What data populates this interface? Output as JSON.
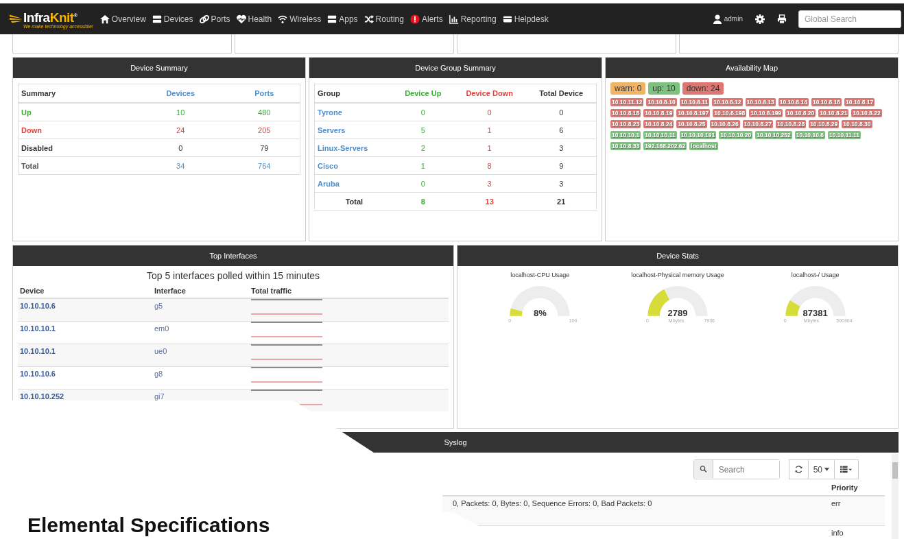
{
  "brand": {
    "name_a": "Infra",
    "name_b": "Knit",
    "reg": "®",
    "tagline": "We make technology accessible!"
  },
  "nav": [
    {
      "kind": "home",
      "label": "Overview"
    },
    {
      "kind": "server",
      "label": "Devices"
    },
    {
      "kind": "link",
      "label": "Ports"
    },
    {
      "kind": "heart",
      "label": "Health"
    },
    {
      "kind": "wifi",
      "label": "Wireless"
    },
    {
      "kind": "server",
      "label": "Apps"
    },
    {
      "kind": "shuffle",
      "label": "Routing"
    },
    {
      "kind": "alert",
      "label": "Alerts"
    },
    {
      "kind": "chart",
      "label": "Reporting"
    },
    {
      "kind": "card",
      "label": "Helpdesk"
    }
  ],
  "user": {
    "name": "admin"
  },
  "global_search": {
    "placeholder": "Global Search"
  },
  "device_summary": {
    "title": "Device Summary",
    "columns": [
      "Summary",
      "Devices",
      "Ports"
    ],
    "rows": [
      {
        "kind": "up",
        "label": "Up",
        "devices": "10",
        "ports": "480"
      },
      {
        "kind": "down",
        "label": "Down",
        "devices": "24",
        "ports": "205"
      },
      {
        "kind": "disabled",
        "label": "Disabled",
        "devices": "0",
        "ports": "79"
      },
      {
        "kind": "total",
        "label": "Total",
        "devices": "34",
        "ports": "764"
      }
    ]
  },
  "group_summary": {
    "title": "Device Group Summary",
    "columns": [
      "Group",
      "Device Up",
      "Device Down",
      "Total Device"
    ],
    "rows": [
      {
        "group": "Tyrone",
        "up": "0",
        "down": "0",
        "total": "0"
      },
      {
        "group": "Servers",
        "up": "5",
        "down": "1",
        "total": "6"
      },
      {
        "group": "Linux-Servers",
        "up": "2",
        "down": "1",
        "total": "3"
      },
      {
        "group": "Cisco",
        "up": "1",
        "down": "8",
        "total": "9"
      },
      {
        "group": "Aruba",
        "up": "0",
        "down": "3",
        "total": "3"
      }
    ],
    "total": {
      "label": "Total",
      "up": "8",
      "down": "13",
      "total": "21"
    }
  },
  "availability": {
    "title": "Availability Map",
    "counts": [
      {
        "kind": "warn",
        "label": "warn: 0"
      },
      {
        "kind": "up",
        "label": "up: 10"
      },
      {
        "kind": "down",
        "label": "down: 24"
      }
    ],
    "hosts": [
      {
        "name": "10.10.11.12",
        "color": "#e07671"
      },
      {
        "name": "10.10.8.10",
        "color": "#e07671"
      },
      {
        "name": "10.10.8.11",
        "color": "#e07671"
      },
      {
        "name": "10.10.8.12",
        "color": "#e07671"
      },
      {
        "name": "10.10.8.13",
        "color": "#e07671"
      },
      {
        "name": "10.10.8.14",
        "color": "#e07671"
      },
      {
        "name": "10.10.8.16",
        "color": "#e07671"
      },
      {
        "name": "10.10.8.17",
        "color": "#e07671"
      },
      {
        "name": "10.10.8.18",
        "color": "#e07671"
      },
      {
        "name": "10.10.8.19",
        "color": "#e07671"
      },
      {
        "name": "10.10.8.197",
        "color": "#e07671"
      },
      {
        "name": "10.10.8.198",
        "color": "#e07671"
      },
      {
        "name": "10.10.8.199",
        "color": "#e07671"
      },
      {
        "name": "10.10.8.20",
        "color": "#e07671"
      },
      {
        "name": "10.10.8.21",
        "color": "#e07671"
      },
      {
        "name": "10.10.8.22",
        "color": "#e07671"
      },
      {
        "name": "10.10.8.23",
        "color": "#e07671"
      },
      {
        "name": "10.10.8.24",
        "color": "#e07671"
      },
      {
        "name": "10.10.8.25",
        "color": "#e07671"
      },
      {
        "name": "10.10.8.26",
        "color": "#e07671"
      },
      {
        "name": "10.10.8.27",
        "color": "#e07671"
      },
      {
        "name": "10.10.8.28",
        "color": "#e07671"
      },
      {
        "name": "10.10.8.29",
        "color": "#e07671"
      },
      {
        "name": "10.10.8.30",
        "color": "#e07671"
      },
      {
        "name": "10.10.10.1",
        "color": "#7cc37d"
      },
      {
        "name": "10.10.10.11",
        "color": "#7cc37d"
      },
      {
        "name": "10.10.10.191",
        "color": "#7cc37d"
      },
      {
        "name": "10.10.10.20",
        "color": "#7cc37d"
      },
      {
        "name": "10.10.10.252",
        "color": "#7cc37d"
      },
      {
        "name": "10.10.10.6",
        "color": "#7cc37d"
      },
      {
        "name": "10.10.11.11",
        "color": "#7cc37d"
      },
      {
        "name": "10.10.8.33",
        "color": "#7cc37d"
      },
      {
        "name": "192.168.202.62",
        "color": "#7cc37d"
      },
      {
        "name": "localhost",
        "color": "#7cc37d"
      }
    ]
  },
  "top_interfaces": {
    "title": "Top Interfaces",
    "subtitle": "Top 5 interfaces polled within 15 minutes",
    "columns": [
      "Device",
      "Interface",
      "Total traffic"
    ],
    "rows": [
      {
        "device": "10.10.10.6",
        "interface": "g5"
      },
      {
        "device": "10.10.10.1",
        "interface": "em0"
      },
      {
        "device": "10.10.10.1",
        "interface": "ue0"
      },
      {
        "device": "10.10.10.6",
        "interface": "g8"
      },
      {
        "device": "10.10.10.252",
        "interface": "gi7"
      }
    ]
  },
  "device_stats": {
    "title": "Device Stats",
    "gauges": [
      {
        "title": "localhost-CPU Usage",
        "value": "8%",
        "min": "0",
        "max": "100",
        "level": 0.08
      },
      {
        "title": "localhost-Physical memory Usage",
        "value": "2789",
        "unit": "Mbytes",
        "min": "0",
        "max": "7936",
        "level": 0.35
      },
      {
        "title": "localhost-/ Usage",
        "value": "87381",
        "unit": "Mbytes",
        "min": "0",
        "max": "500304",
        "level": 0.175
      }
    ]
  },
  "syslog": {
    "title": "Syslog",
    "search": {
      "placeholder": "Search"
    },
    "page_size": "50",
    "columns": [
      "Priority"
    ],
    "rows": [
      {
        "message": "0, Packets: 0, Bytes: 0, Sequence Errors: 0, Bad Packets: 0",
        "priority": "err"
      },
      {
        "priority": "info"
      }
    ]
  },
  "slide_heading": "Elemental Specifications"
}
